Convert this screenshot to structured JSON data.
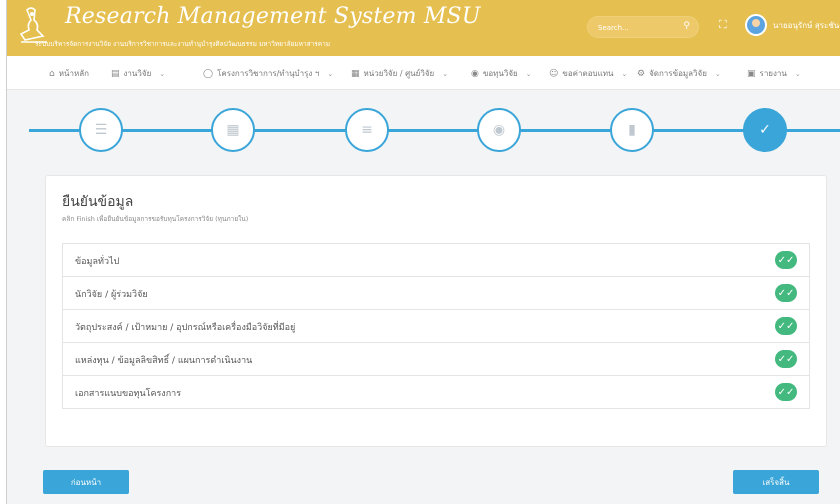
{
  "header": {
    "title": "Research Management System MSU",
    "subtitle": "ระบบบริหารจัดการงานวิจัย งานบริการวิชาการและงานทำนุบำรุงศิลปวัฒนธรรม มหาวิทยาลัยมหาสารคาม",
    "search_placeholder": "Search...",
    "user_name": "นายอนุรักษ์ สุระชันต์",
    "brand_color": "#e5bf4f"
  },
  "nav": {
    "items": [
      {
        "label": "หน้าหลัก",
        "icon": "home-icon",
        "has_dropdown": false
      },
      {
        "label": "งานวิจัย",
        "icon": "document-icon",
        "has_dropdown": true
      },
      {
        "label": "โครงการวิชาการ/ทำนุบำรุง ฯ",
        "icon": "shield-icon",
        "has_dropdown": true
      },
      {
        "label": "หน่วยวิจัย / ศูนย์วิจัย",
        "icon": "building-icon",
        "has_dropdown": true
      },
      {
        "label": "ขอทุนวิจัย",
        "icon": "coin-icon",
        "has_dropdown": true
      },
      {
        "label": "ขอค่าตอบแทน",
        "icon": "people-icon",
        "has_dropdown": true
      },
      {
        "label": "จัดการข้อมูลวิจัย",
        "icon": "gear-icon",
        "has_dropdown": true
      },
      {
        "label": "รายงาน",
        "icon": "report-icon",
        "has_dropdown": true
      }
    ]
  },
  "stepper": {
    "accent_color": "#3aa5d8",
    "active_step": 6,
    "steps": [
      {
        "icon": "list-icon"
      },
      {
        "icon": "book-icon"
      },
      {
        "icon": "checklist-icon"
      },
      {
        "icon": "money-icon"
      },
      {
        "icon": "file-icon"
      },
      {
        "icon": "check-icon"
      }
    ]
  },
  "card": {
    "title": "ยืนยันข้อมูล",
    "subtitle": "คลิก Finish เพื่อยืนยันข้อมูลการขอรับทุนโครงการวิจัย (ทุนภายใน)",
    "items": [
      {
        "label": "ข้อมูลทั่วไป",
        "status": "complete"
      },
      {
        "label": "นักวิจัย / ผู้ร่วมวิจัย",
        "status": "complete"
      },
      {
        "label": "วัตถุประสงค์ / เป้าหมาย / อุปกรณ์หรือเครื่องมือวิจัยที่มีอยู่",
        "status": "complete"
      },
      {
        "label": "แหล่งทุน / ข้อมูลลิขสิทธิ์ / แผนการดำเนินงาน",
        "status": "complete"
      },
      {
        "label": "เอกสารแนบขอทุนโครงการ",
        "status": "complete"
      }
    ],
    "check_color": "#43b97f"
  },
  "buttons": {
    "prev_label": "ก่อนหน้า",
    "finish_label": "เสร็จสิ้น"
  }
}
